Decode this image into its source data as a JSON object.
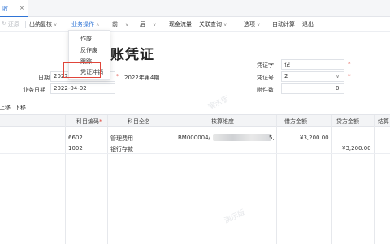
{
  "tab": {
    "label": "收",
    "close": "×"
  },
  "toolbar": {
    "items": [
      "还原",
      "出纳复核",
      "业务操作",
      "前一",
      "后一",
      "现金流量",
      "关联查询",
      "选项",
      "自动计算",
      "退出"
    ]
  },
  "dropdown": {
    "items": [
      "作废",
      "反作废",
      "跟踪",
      "凭证冲销"
    ]
  },
  "title": "账凭证",
  "header": {
    "date_label": "日期",
    "date_value": "2022",
    "period": "2022年第4期",
    "biz_date_label": "业务日期",
    "biz_date_value": "2022-04-02",
    "voucher_word_label": "凭证字",
    "voucher_word_value": "记",
    "voucher_no_label": "凭证号",
    "voucher_no_value": "2",
    "attach_label": "附件数",
    "attach_value": "0",
    "required_mark": "*"
  },
  "actions": {
    "move_up": "上移",
    "move_down": "下移"
  },
  "grid": {
    "columns": [
      "科目编码",
      "科目全名",
      "核算维度",
      "借方金额",
      "贷方金额",
      "结算"
    ],
    "rows": [
      {
        "code": "6602",
        "name": "管理费用",
        "dim": "BM000004/",
        "dim_tail": "5,",
        "debit": "¥3,200.00",
        "credit": ""
      },
      {
        "code": "1002",
        "name": "银行存款",
        "dim": "",
        "dim_tail": "",
        "debit": "",
        "credit": "¥3,200.00"
      }
    ],
    "watermark": "演示版"
  }
}
